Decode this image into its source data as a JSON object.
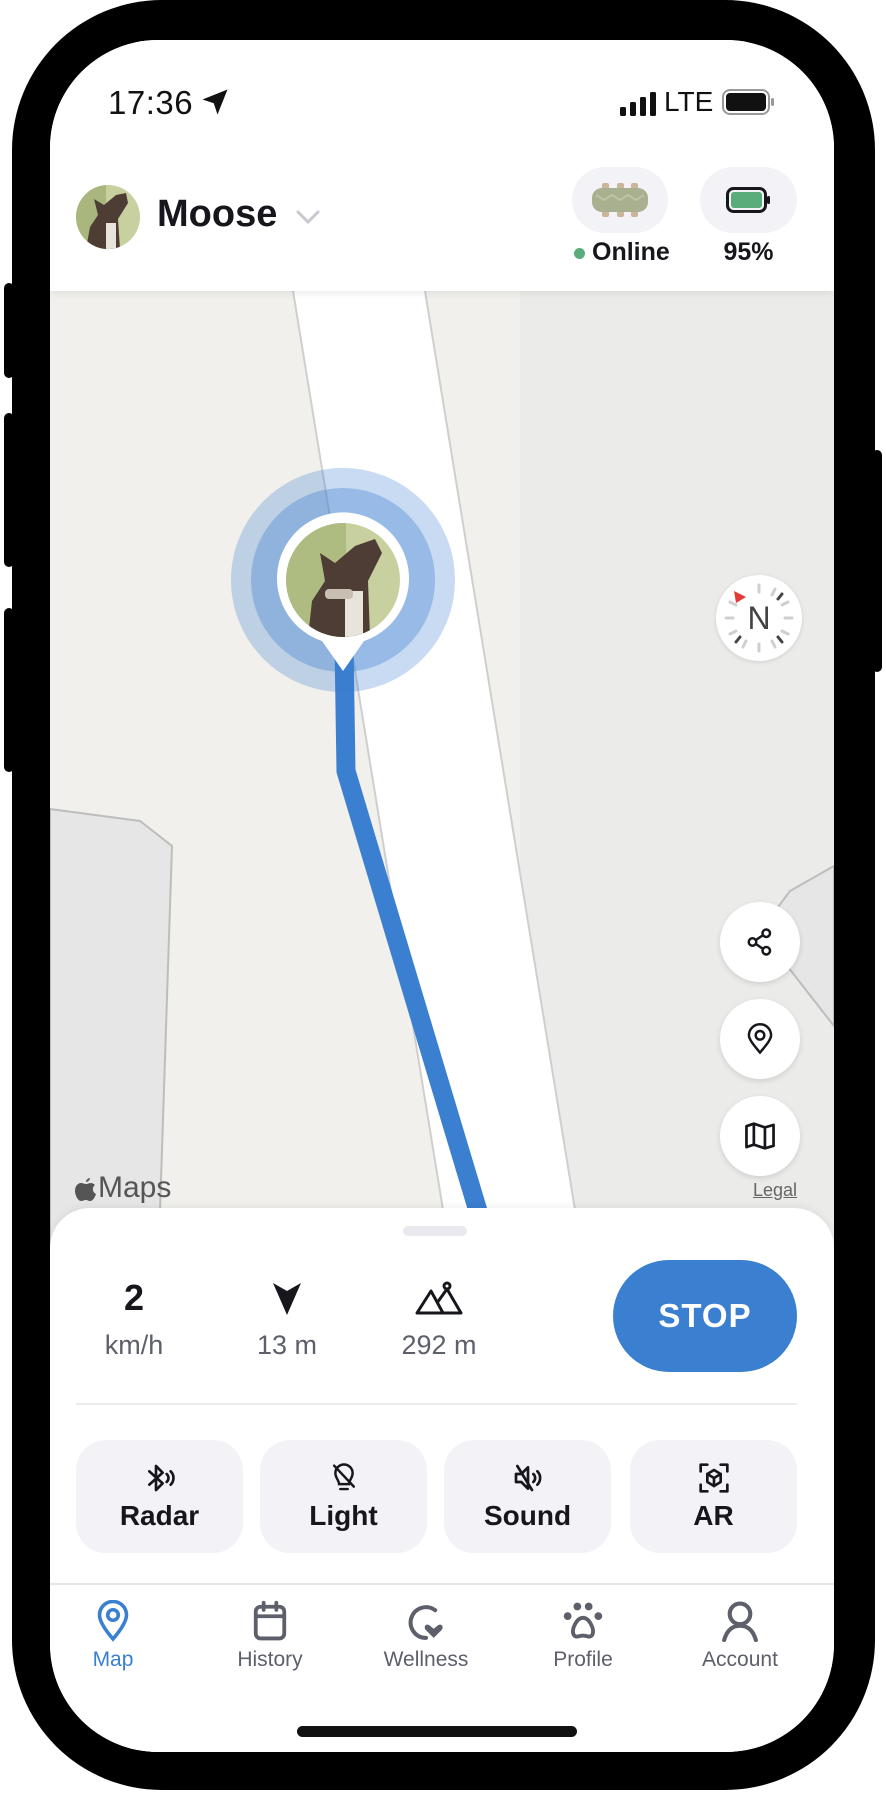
{
  "status_bar": {
    "time": "17:36",
    "network": "LTE",
    "icons": [
      "location-arrow-icon",
      "signal-icon",
      "battery-icon"
    ]
  },
  "header": {
    "pet_name": "Moose",
    "device_status": "Online",
    "battery_percent": "95%",
    "colors": {
      "online": "#5aad7a",
      "battery_fill": "#5aad7a"
    }
  },
  "map": {
    "compass_label": "N",
    "attribution": "Maps",
    "legal_label": "Legal",
    "buttons": [
      {
        "name": "share",
        "icon": "share-icon"
      },
      {
        "name": "location",
        "icon": "map-pin-icon"
      },
      {
        "name": "map-type",
        "icon": "map-icon"
      }
    ],
    "track_color": "#3b7fd0"
  },
  "stats": {
    "speed_value": "2",
    "speed_unit": "km/h",
    "distance_value": "13 m",
    "altitude_value": "292 m",
    "stop_label": "STOP"
  },
  "actions": [
    {
      "label": "Radar",
      "icon": "bluetooth-radar-icon"
    },
    {
      "label": "Light",
      "icon": "light-off-icon"
    },
    {
      "label": "Sound",
      "icon": "sound-muted-icon"
    },
    {
      "label": "AR",
      "icon": "ar-cube-icon"
    }
  ],
  "tabs": [
    {
      "label": "Map",
      "icon": "map-pin-icon",
      "active": true
    },
    {
      "label": "History",
      "icon": "calendar-icon",
      "active": false
    },
    {
      "label": "Wellness",
      "icon": "wellness-heart-icon",
      "active": false
    },
    {
      "label": "Profile",
      "icon": "paw-icon",
      "active": false
    },
    {
      "label": "Account",
      "icon": "person-icon",
      "active": false
    }
  ],
  "accent_color": "#3b7fd0"
}
